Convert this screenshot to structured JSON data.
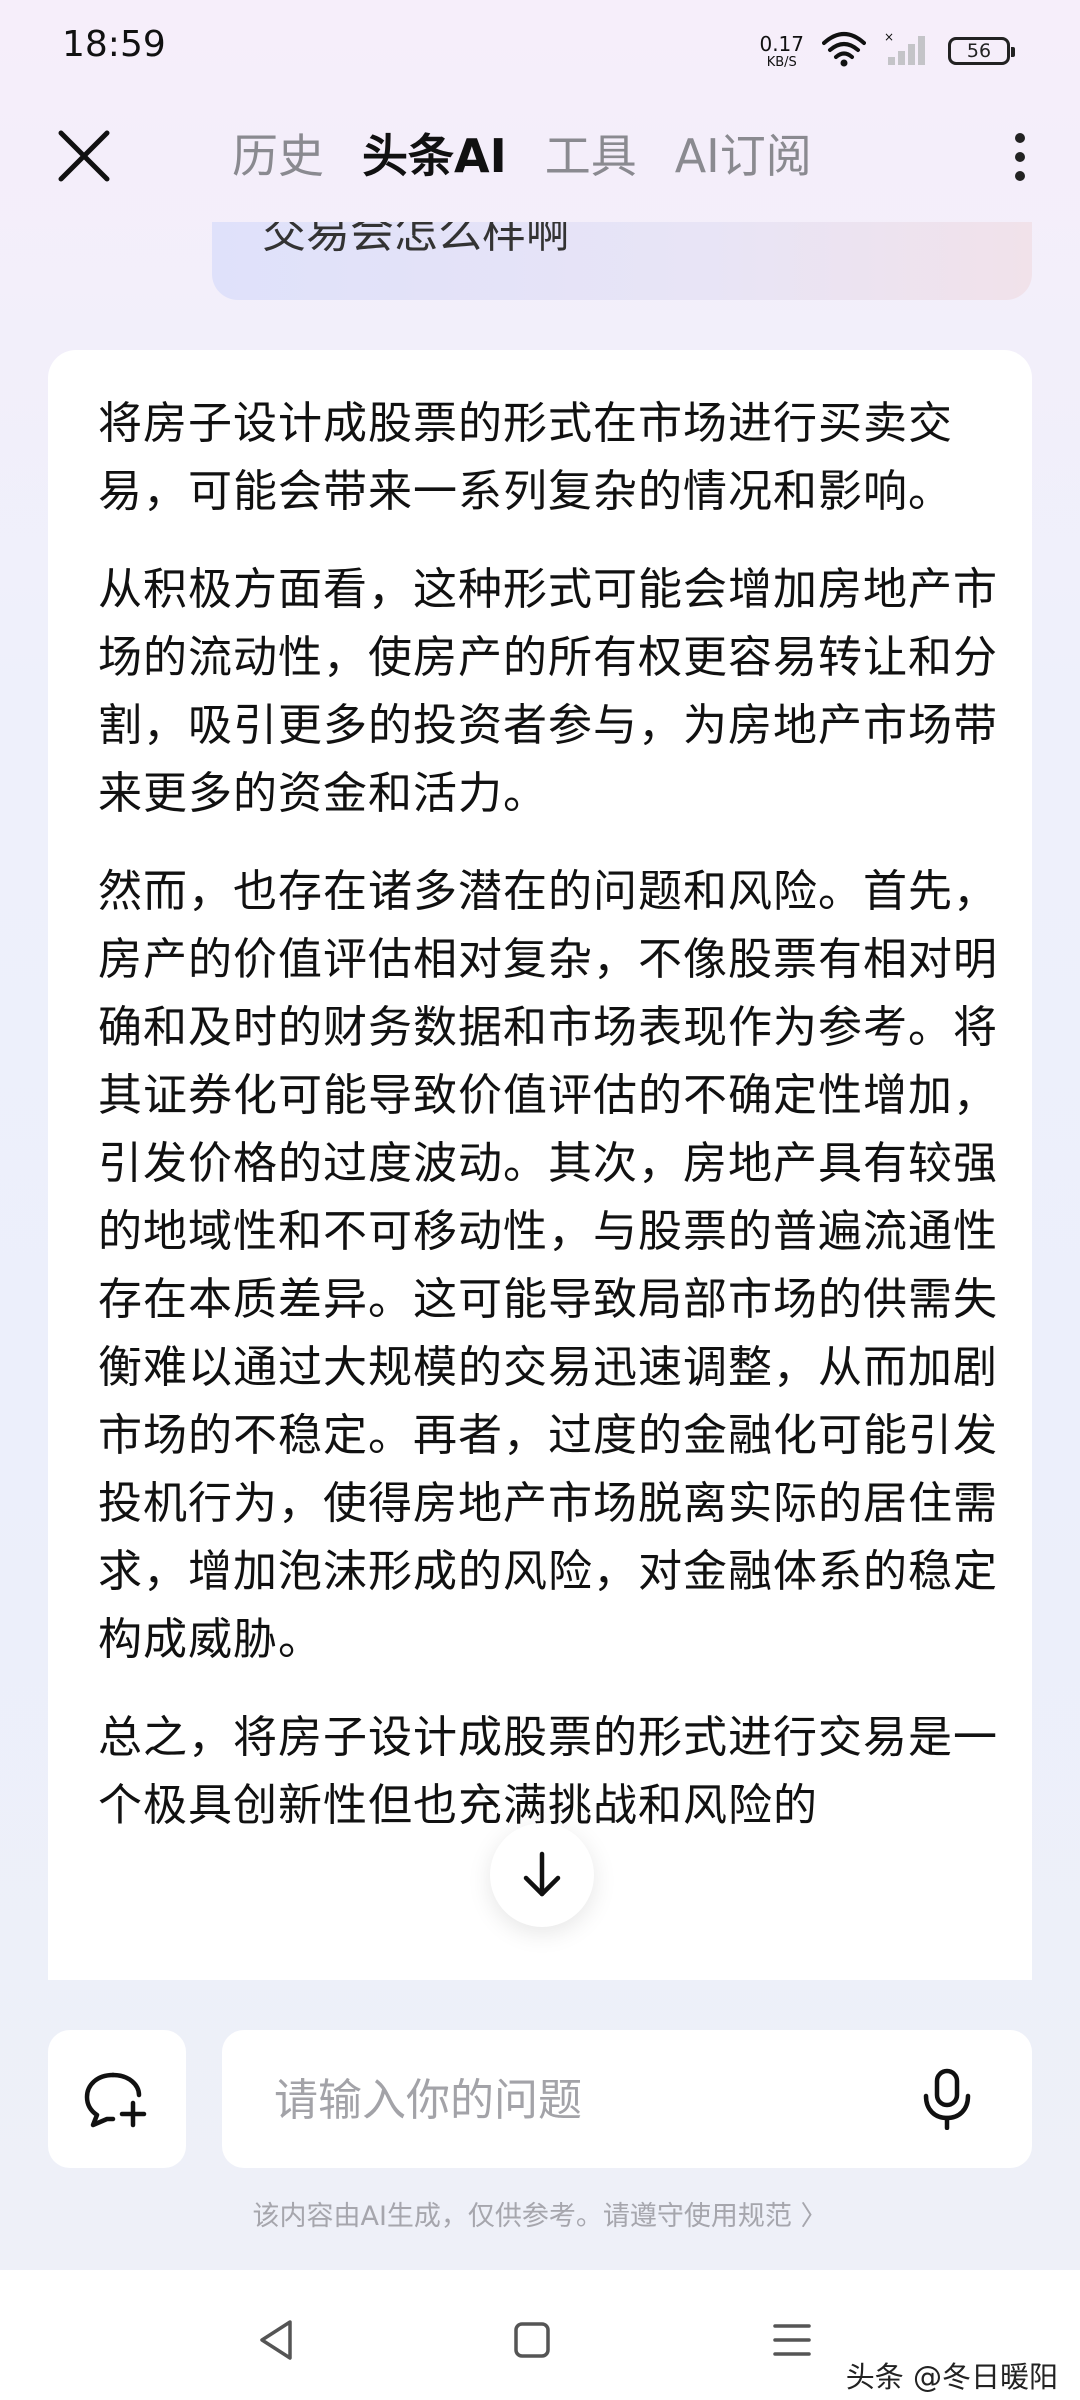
{
  "status_bar": {
    "time": "18:59",
    "net_speed": "0.17",
    "net_unit": "KB/S",
    "battery": "56"
  },
  "nav": {
    "tabs": [
      {
        "label": "历史",
        "active": false
      },
      {
        "label": "头条AI",
        "active": true
      },
      {
        "label": "工具",
        "active": false
      },
      {
        "label": "AI订阅",
        "active": false
      }
    ]
  },
  "user_message": {
    "text": "交易会怎么样啊"
  },
  "answer": {
    "paragraphs": [
      "将房子设计成股票的形式在市场进行买卖交易，可能会带来一系列复杂的情况和影响。",
      "从积极方面看，这种形式可能会增加房地产市场的流动性，使房产的所有权更容易转让和分割，吸引更多的投资者参与，为房地产市场带来更多的资金和活力。",
      "然而，也存在诸多潜在的问题和风险。首先，房产的价值评估相对复杂，不像股票有相对明确和及时的财务数据和市场表现作为参考。将其证券化可能导致价值评估的不确定性增加，引发价格的过度波动。其次，房地产具有较强的地域性和不可移动性，与股票的普遍流通性存在本质差异。这可能导致局部市场的供需失衡难以通过大规模的交易迅速调整，从而加剧市场的不稳定。再者，过度的金融化可能引发投机行为，使得房地产市场脱离实际的居住需求，增加泡沫形成的风险，对金融体系的稳定构成威胁。",
      "总之，将房子设计成股票的形式进行交易是一个极具创新性但也充满挑战和风险的"
    ]
  },
  "input": {
    "placeholder": "请输入你的问题",
    "value": ""
  },
  "disclaimer": "该内容由AI生成，仅供参考。请遵守使用规范 〉",
  "watermark": "头条 @冬日暖阳"
}
